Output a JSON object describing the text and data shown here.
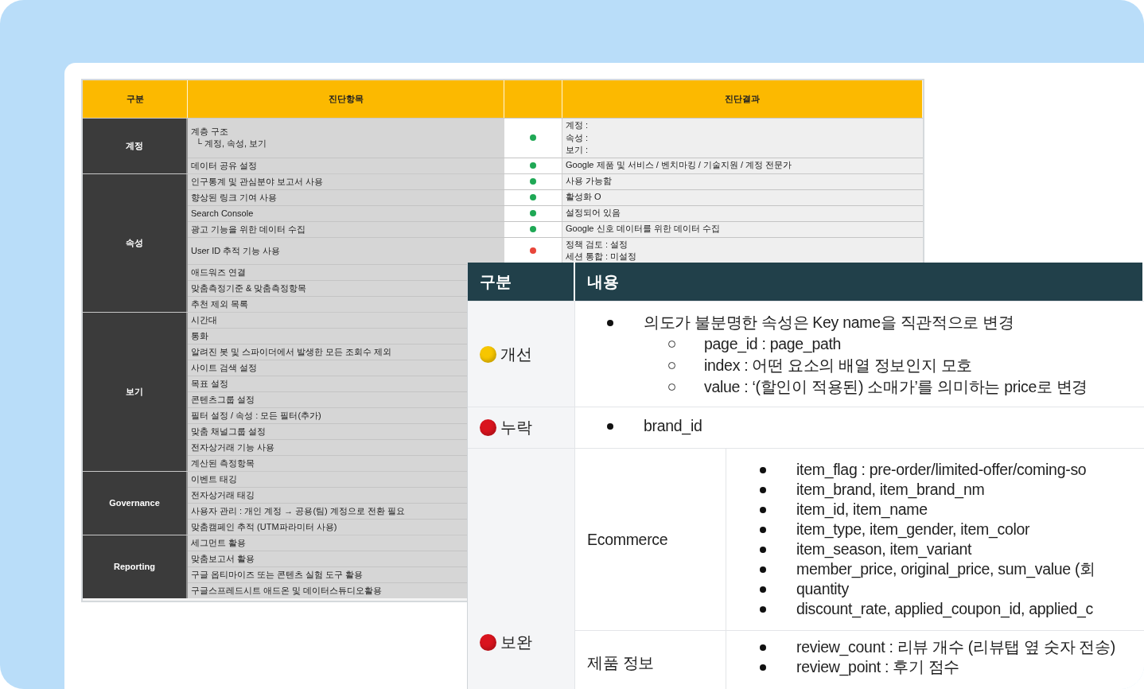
{
  "sheet": {
    "columns": [
      {
        "label": "구분"
      },
      {
        "label": "진단항목"
      },
      {
        "label": "진단결과"
      }
    ],
    "groups": [
      {
        "category": "계정",
        "rows": [
          {
            "item": "계층 구조\n  └ 계정, 속성, 보기",
            "status": {
              "color": "#1fa855"
            },
            "result": "계정 :\n속성 :\n보기 :"
          },
          {
            "item": "데이터 공유 설정",
            "status": {
              "color": "#1fa855"
            },
            "result": "Google 제품 및 서비스 / 벤치마킹 / 기술지원 / 계정 전문가"
          }
        ]
      },
      {
        "category": "속성",
        "rows": [
          {
            "item": "인구통계 및 관심분야 보고서 사용",
            "status": {
              "color": "#1fa855"
            },
            "result": "사용 가능함"
          },
          {
            "item": "향상된 링크 기여 사용",
            "status": {
              "color": "#1fa855"
            },
            "result": "활성화 O"
          },
          {
            "item": "Search Console",
            "status": {
              "color": "#1fa855"
            },
            "result": "설정되어 있음"
          },
          {
            "item": "광고 기능을 위한 데이터 수집",
            "status": {
              "color": "#1fa855"
            },
            "result": "Google 신호 데이터를 위한 데이터 수집"
          },
          {
            "item": "User ID 추적 기능 사용",
            "status": {
              "color": "#e8463a"
            },
            "result": "정책 검토 : 설정\n세션 통합 : 미설정"
          },
          {
            "item": "애드워즈 연결"
          },
          {
            "item": "맞춤측정기준 & 맞춤측정항목"
          },
          {
            "item": "추천 제외 목록"
          }
        ]
      },
      {
        "category": "보기",
        "rows": [
          {
            "item": "시간대"
          },
          {
            "item": "통화"
          },
          {
            "item": "알려진 봇 및 스파이더에서 발생한 모든 조회수 제외"
          },
          {
            "item": "사이트 검색 설정"
          },
          {
            "item": "목표 설정"
          },
          {
            "item": "콘텐츠그룹 설정"
          },
          {
            "item": "필터 설정 / 속성 : 모든 필터(추가)"
          },
          {
            "item": "맞춤 채널그룹 설정"
          },
          {
            "item": "전자상거래 기능 사용"
          },
          {
            "item": "계산된 측정항목"
          }
        ]
      },
      {
        "category": "Governance",
        "rows": [
          {
            "item": "이벤트 태깅"
          },
          {
            "item": "전자상거래 태깅"
          },
          {
            "item": "사용자 관리 : 개인 계정 → 공용(팀) 계정으로 전환 필요"
          },
          {
            "item": "맞춤캠페인 추적 (UTM파라미터 사용)"
          }
        ]
      },
      {
        "category": "Reporting",
        "rows": [
          {
            "item": "세그먼트 활용"
          },
          {
            "item": "맞춤보고서 활용"
          },
          {
            "item": "구글 옵티마이즈 또는 콘텐츠 실험 도구 활용"
          },
          {
            "item": "구글스프레드시트 애드온 및 데이터스튜디오활용"
          }
        ]
      }
    ]
  },
  "document": {
    "columns": [
      {
        "label": "구분"
      },
      {
        "label": "내용"
      }
    ],
    "rows": [
      {
        "kind": "list",
        "label": "개선",
        "color": "#f7c600",
        "bullets": [
          {
            "text": "의도가 불분명한 속성은 Key name을 직관적으로 변경",
            "children": [
              {
                "text": "page_id : page_path"
              },
              {
                "text": "index : 어떤 요소의 배열 정보인지 모호"
              },
              {
                "text": "value : ‘(할인이 적용된) 소매가’를 의미하는 price로 변경"
              }
            ]
          }
        ]
      },
      {
        "kind": "list",
        "label": "누락",
        "color": "#d9141e",
        "bullets": [
          {
            "text": "brand_id"
          }
        ]
      },
      {
        "kind": "sections",
        "label": "보완",
        "color": "#d9141e",
        "sections": [
          {
            "title": "Ecommerce",
            "bullets": [
              {
                "text": "item_flag : pre-order/limited-offer/coming-so"
              },
              {
                "text": "item_brand, item_brand_nm"
              },
              {
                "text": "item_id, item_name"
              },
              {
                "text": "item_type, item_gender, item_color"
              },
              {
                "text": "item_season, item_variant"
              },
              {
                "text": "member_price, original_price, sum_value (회"
              },
              {
                "text": "quantity"
              },
              {
                "text": "discount_rate, applied_coupon_id, applied_c"
              }
            ]
          },
          {
            "title": "제품 정보",
            "bullets": [
              {
                "text": "review_count : 리뷰 개수 (리뷰탭 옆 숫자 전송)"
              },
              {
                "text": "review_point : 후기 점수"
              }
            ]
          }
        ]
      }
    ]
  }
}
